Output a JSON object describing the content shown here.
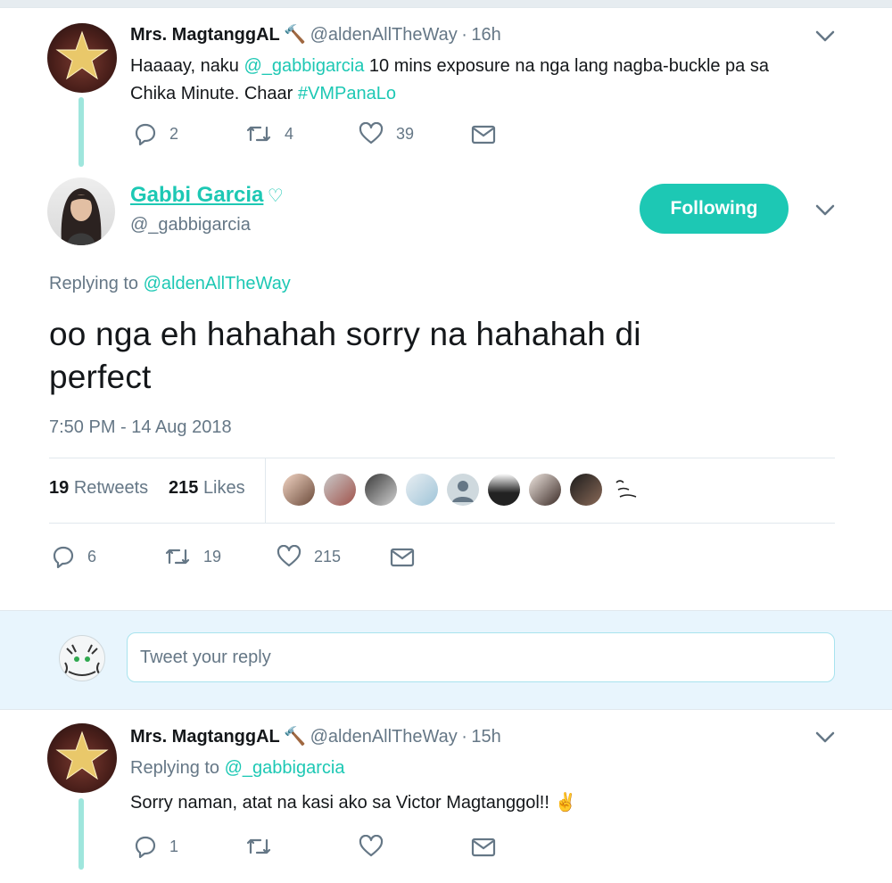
{
  "tweet1": {
    "name": "Mrs. MagtanggAL",
    "name_emoji": "🔨",
    "handle": "@aldenAllTheWay",
    "sep": "·",
    "time": "16h",
    "text_a": "Haaaay, naku ",
    "mention": "@_gabbigarcia",
    "text_b": " 10 mins exposure na nga lang nagba-buckle pa sa",
    "text_c": "Chika Minute. Chaar ",
    "hashtag": "#VMPanaLo",
    "replies": "2",
    "retweets": "4",
    "likes": "39"
  },
  "main": {
    "name": "Gabbi Garcia",
    "heart": "♡",
    "handle": "@_gabbigarcia",
    "follow_label": "Following",
    "replying_prefix": "Replying to ",
    "replying_to": "@aldenAllTheWay",
    "text_line1": "oo nga eh hahahah sorry na hahahah di",
    "text_line2": "perfect",
    "timestamp": "7:50 PM - 14 Aug 2018",
    "retweet_count": "19",
    "retweet_label": "Retweets",
    "like_count": "215",
    "like_label": "Likes",
    "replies": "6",
    "retweets": "19",
    "likes": "215"
  },
  "reply_box": {
    "placeholder": "Tweet your reply"
  },
  "tweet2": {
    "name": "Mrs. MagtanggAL",
    "name_emoji": "🔨",
    "handle": "@aldenAllTheWay",
    "sep": "·",
    "time": "15h",
    "replying_prefix": "Replying to ",
    "replying_to": "@_gabbigarcia",
    "text": "Sorry naman, atat na kasi ako sa Victor Magtanggol!! ",
    "emoji": "✌",
    "replies": "1"
  },
  "colors": {
    "accent": "#1dc8b4",
    "text": "#14171a",
    "muted": "#657786",
    "reply_band": "#e8f5fd"
  }
}
